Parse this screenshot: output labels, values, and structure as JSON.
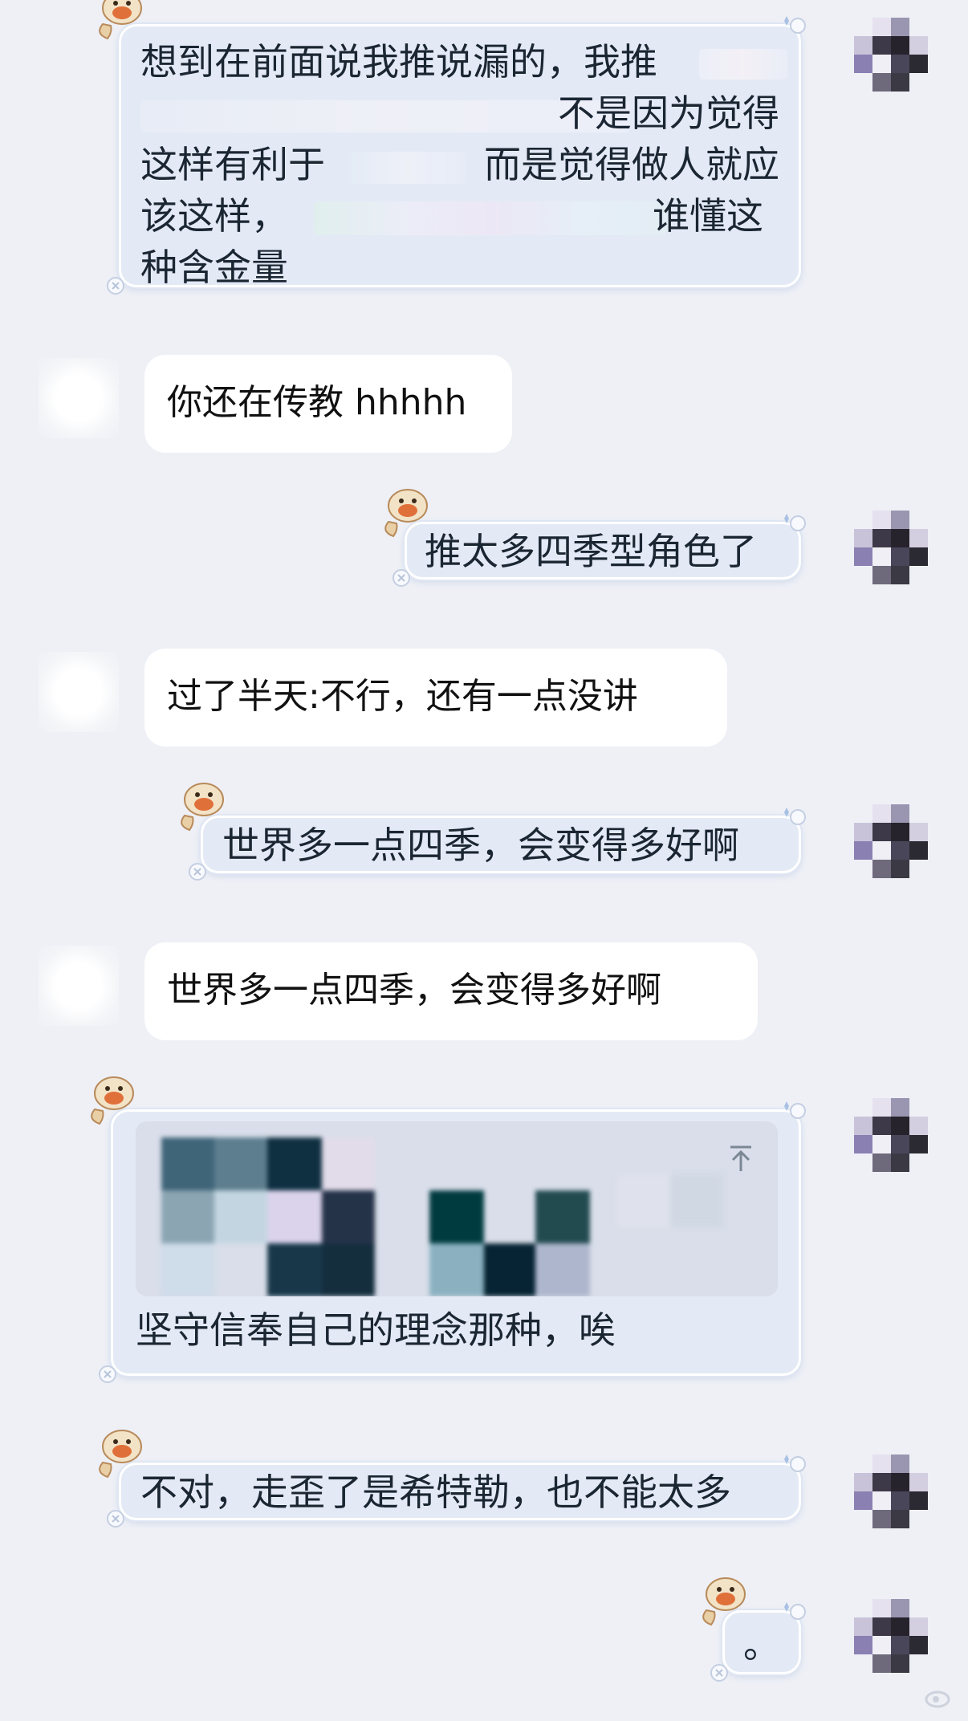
{
  "messages": [
    {
      "side": "right",
      "lines": [
        "想到在前面说我推说漏的，我推",
        "不是因为觉得",
        "这样有利于",
        "而是觉得做人就应",
        "该这样，",
        "谁懂这",
        "种含金量"
      ]
    },
    {
      "side": "left",
      "text": "你还在传教 hhhhh"
    },
    {
      "side": "right",
      "text": "推太多四季型角色了"
    },
    {
      "side": "left",
      "text": "过了半天:不行，还有一点没讲"
    },
    {
      "side": "right",
      "text": "世界多一点四季，会变得多好啊"
    },
    {
      "side": "left",
      "text": "世界多一点四季，会变得多好啊"
    },
    {
      "side": "right",
      "quote_icon": "pin-top-icon",
      "text": "坚守信奉自己的理念那种，唉"
    },
    {
      "side": "right",
      "text": "不对，走歪了是希特勒，也不能太多"
    },
    {
      "side": "right",
      "text": "。"
    }
  ],
  "colors": {
    "background": "#eef0f6",
    "right_bubble": "#e4eaf5",
    "left_bubble": "#ffffff",
    "text": "#1b2633"
  }
}
